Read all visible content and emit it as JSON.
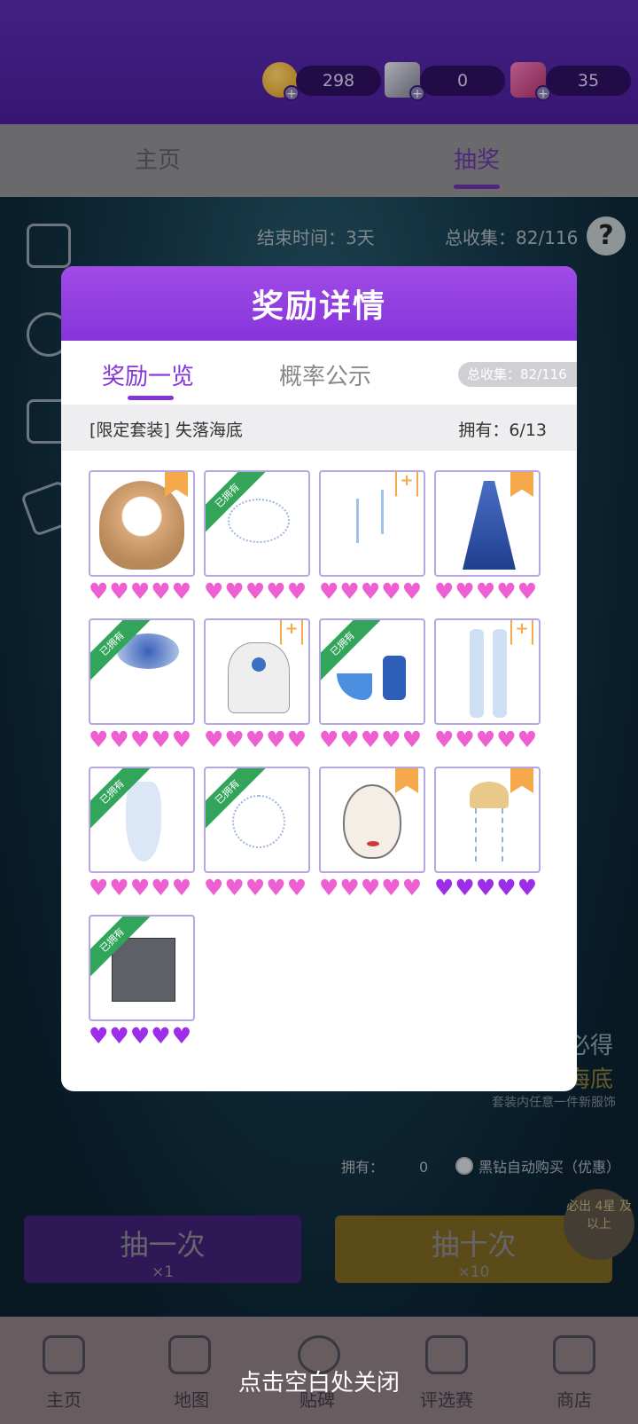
{
  "currency": {
    "coins": "298",
    "diamonds": "0",
    "gems": "35"
  },
  "main_tabs": [
    "主页",
    "抽奖"
  ],
  "info": {
    "end_time": "结束时间：3天",
    "total_collect": "总收集：82/116",
    "help": "?"
  },
  "promo": {
    "line1": "必得",
    "line2": "海底",
    "line3": "套装内任意一件新服饰"
  },
  "draw": {
    "own_label": "拥有：",
    "own_count": "0",
    "auto_buy": "黑钻自动购买（优惠）",
    "once_label": "抽一次",
    "once_cost": "×1",
    "ten_label": "抽十次",
    "ten_cost": "×10",
    "badge": "必出 4星 及以上"
  },
  "bottom_nav": [
    "主页",
    "地图",
    "贴碑",
    "评选赛",
    "商店"
  ],
  "close_hint": "点击空白处关闭",
  "modal": {
    "title": "奖励详情",
    "tabs": [
      "奖励一览",
      "概率公示"
    ],
    "collect_pill": "总收集：82/116",
    "set_name": "[限定套装] 失落海底",
    "set_owned": "拥有：6/13",
    "owned_ribbon": "已拥有",
    "items": [
      {
        "name": "hair",
        "status": "new-bookmark",
        "hearts": 5,
        "heart_color": "#ee5fd1"
      },
      {
        "name": "hair-accessory",
        "status": "owned",
        "hearts": 5,
        "heart_color": "#ee5fd1"
      },
      {
        "name": "earrings",
        "status": "plus",
        "hearts": 5,
        "heart_color": "#ee5fd1"
      },
      {
        "name": "dress",
        "status": "new-bookmark",
        "hearts": 5,
        "heart_color": "#ee5fd1"
      },
      {
        "name": "hat",
        "status": "owned",
        "hearts": 5,
        "heart_color": "#ee5fd1"
      },
      {
        "name": "necklace",
        "status": "plus",
        "hearts": 5,
        "heart_color": "#ee5fd1"
      },
      {
        "name": "shoes",
        "status": "owned",
        "hearts": 5,
        "heart_color": "#ee5fd1"
      },
      {
        "name": "stockings",
        "status": "plus",
        "hearts": 5,
        "heart_color": "#ee5fd1"
      },
      {
        "name": "gloves",
        "status": "owned",
        "hearts": 5,
        "heart_color": "#ee5fd1"
      },
      {
        "name": "bracelet",
        "status": "owned",
        "hearts": 5,
        "heart_color": "#ee5fd1"
      },
      {
        "name": "makeup",
        "status": "new-bookmark",
        "hearts": 5,
        "heart_color": "#ee5fd1"
      },
      {
        "name": "jellyfish-accessory",
        "status": "new-bookmark",
        "hearts": 5,
        "heart_color": "#9c2eea"
      },
      {
        "name": "background",
        "status": "owned",
        "hearts": 5,
        "heart_color": "#9c2eea"
      }
    ]
  }
}
